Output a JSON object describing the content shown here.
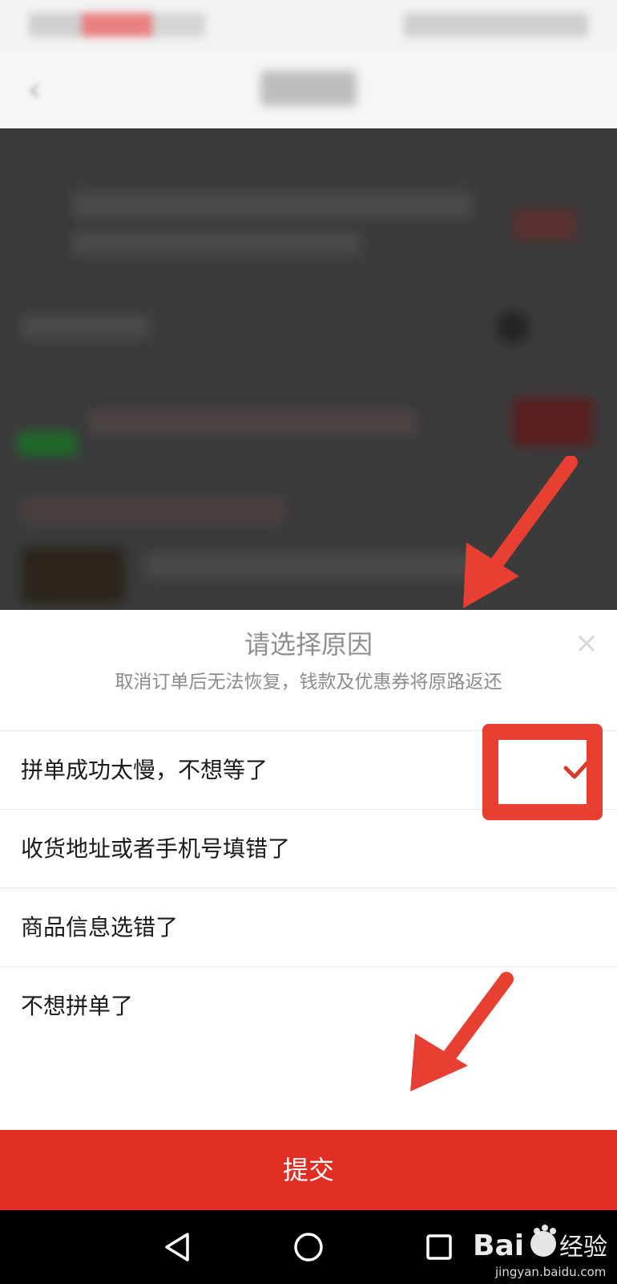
{
  "sheet": {
    "title": "请选择原因",
    "subtitle": "取消订单后无法恢复，钱款及优惠券将原路返还",
    "close_icon": "close-icon",
    "reasons": [
      {
        "label": "拼单成功太慢，不想等了",
        "selected": true
      },
      {
        "label": "收货地址或者手机号填错了",
        "selected": false
      },
      {
        "label": "商品信息选错了",
        "selected": false
      },
      {
        "label": "不想拼单了",
        "selected": false
      }
    ],
    "submit_label": "提交"
  },
  "colors": {
    "accent": "#e02e24",
    "annotation": "#e74032",
    "check": "#d93a2b"
  },
  "system_nav": {
    "icons": [
      "back-triangle-icon",
      "home-circle-icon",
      "recents-square-icon"
    ]
  },
  "watermark": {
    "text": "Bai 经验",
    "url": "jingyan.baidu.com"
  }
}
